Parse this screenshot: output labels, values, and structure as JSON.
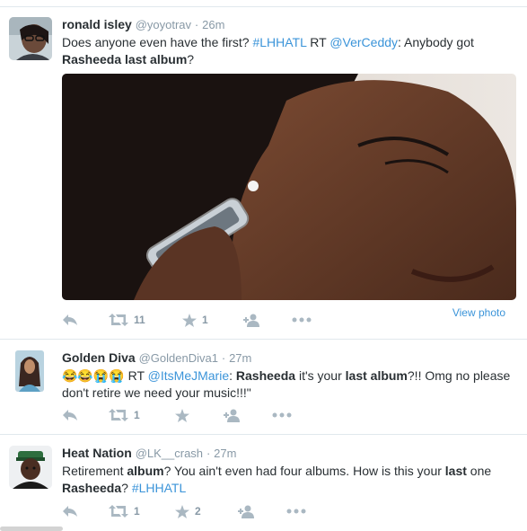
{
  "tweets": [
    {
      "fullname": "ronald isley",
      "username": "@yoyotrav",
      "time": "26m",
      "text": {
        "p1": "Does anyone even have the first? ",
        "hashtag": "#LHHATL",
        "p2": " RT ",
        "mention": "@VerCeddy",
        "p3": ": Anybody got ",
        "bold1": "Rasheeda last album",
        "p4": "?"
      },
      "retweets": "11",
      "favorites": "1",
      "view_photo": "View photo"
    },
    {
      "fullname": "Golden Diva",
      "username": "@GoldenDiva1",
      "time": "27m",
      "text": {
        "emojis": "😂😂😭😭",
        "p1": " RT ",
        "mention": "@ItsMeJMarie",
        "p2": ": ",
        "bold1": "Rasheeda",
        "p3": " it's your ",
        "bold2": "last album",
        "p4": "?!! Omg no please",
        "p5": "don't retire we need your music!!!\""
      },
      "retweets": "1",
      "favorites": ""
    },
    {
      "fullname": "Heat Nation",
      "username": "@LK__crash",
      "time": "27m",
      "text": {
        "p1": "Retirement ",
        "bold1": "album",
        "p2": "? You ain't even had four albums. How is this your ",
        "bold2": "last",
        "p3": " one",
        "bold3": "Rasheeda",
        "p4": "? ",
        "hashtag": "#LHHATL"
      },
      "retweets": "1",
      "favorites": "2"
    }
  ],
  "icons": [
    "reply-icon",
    "retweet-icon",
    "favorite-icon",
    "follow-icon",
    "more-icon"
  ],
  "colors": {
    "link": "#3b94d9",
    "muted": "#8899a6",
    "icon": "#aab8c2",
    "text": "#292f33"
  }
}
